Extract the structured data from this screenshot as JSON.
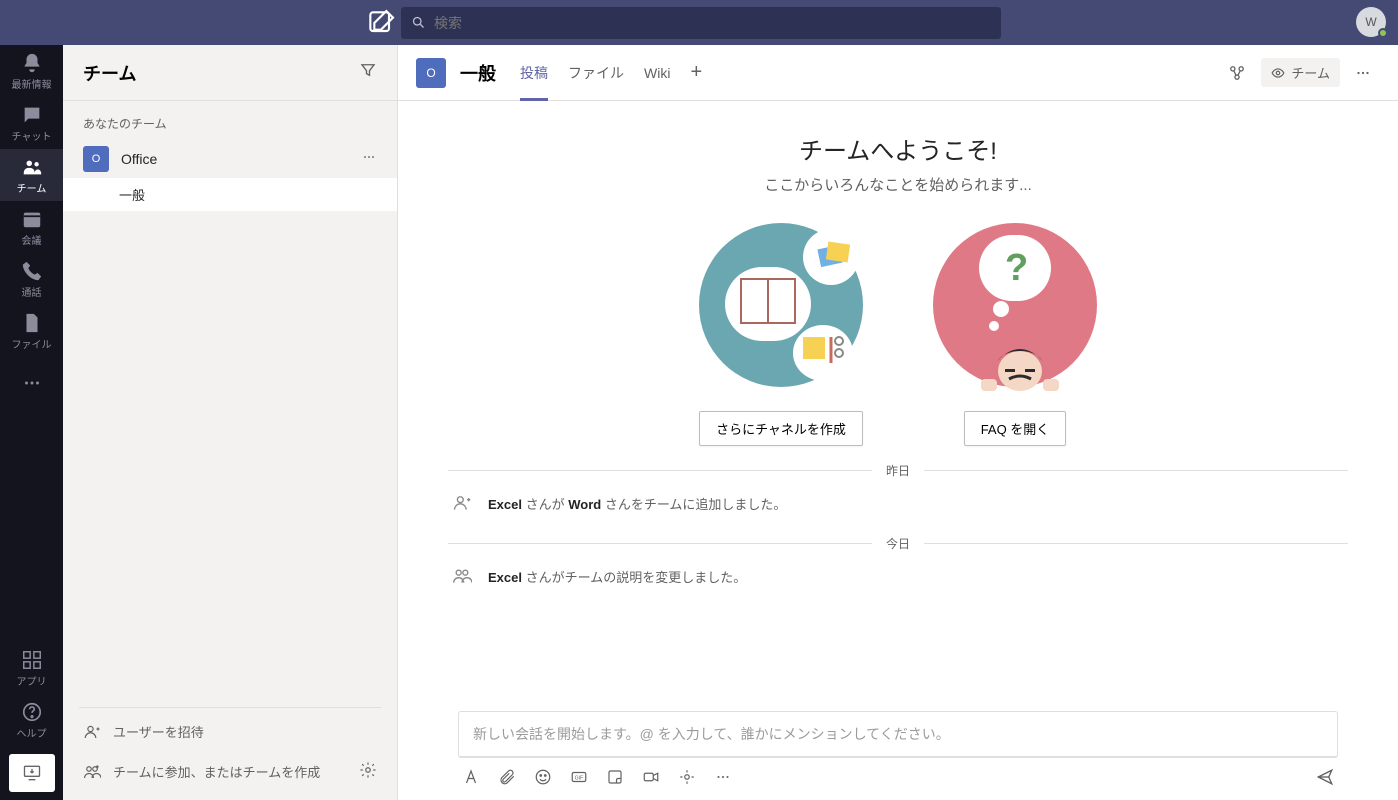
{
  "topbar": {
    "search_placeholder": "検索",
    "avatar_initial": "W"
  },
  "rail": {
    "items": [
      {
        "id": "activity",
        "label": "最新情報"
      },
      {
        "id": "chat",
        "label": "チャット"
      },
      {
        "id": "teams",
        "label": "チーム",
        "active": true
      },
      {
        "id": "meetings",
        "label": "会議"
      },
      {
        "id": "calls",
        "label": "通話"
      },
      {
        "id": "files",
        "label": "ファイル"
      }
    ],
    "more_label": "",
    "apps_label": "アプリ",
    "help_label": "ヘルプ"
  },
  "panel": {
    "title": "チーム",
    "section_label": "あなたのチーム",
    "team": {
      "name": "Office",
      "initial": "O"
    },
    "channel": "一般",
    "invite_label": "ユーザーを招待",
    "join_create_label": "チームに参加、またはチームを作成"
  },
  "header": {
    "channel_title": "一般",
    "tile_initial": "O",
    "tabs": [
      {
        "id": "posts",
        "label": "投稿",
        "active": true
      },
      {
        "id": "files",
        "label": "ファイル"
      },
      {
        "id": "wiki",
        "label": "Wiki"
      }
    ],
    "team_button": "チーム"
  },
  "welcome": {
    "title": "チームへようこそ!",
    "subtitle": "ここからいろんなことを始められます...",
    "create_channel_btn": "さらにチャネルを作成",
    "faq_btn": "FAQ を開く"
  },
  "timeline": {
    "yesterday": "昨日",
    "today": "今日",
    "msg_add_before": "Excel",
    "msg_add_mid": " さんが ",
    "msg_add_user": "Word",
    "msg_add_after": " さんをチームに追加しました。",
    "msg_desc_before": "Excel",
    "msg_desc_after": " さんがチームの説明を変更しました。"
  },
  "compose": {
    "placeholder": "新しい会話を開始します。@ を入力して、誰かにメンションしてください。"
  }
}
